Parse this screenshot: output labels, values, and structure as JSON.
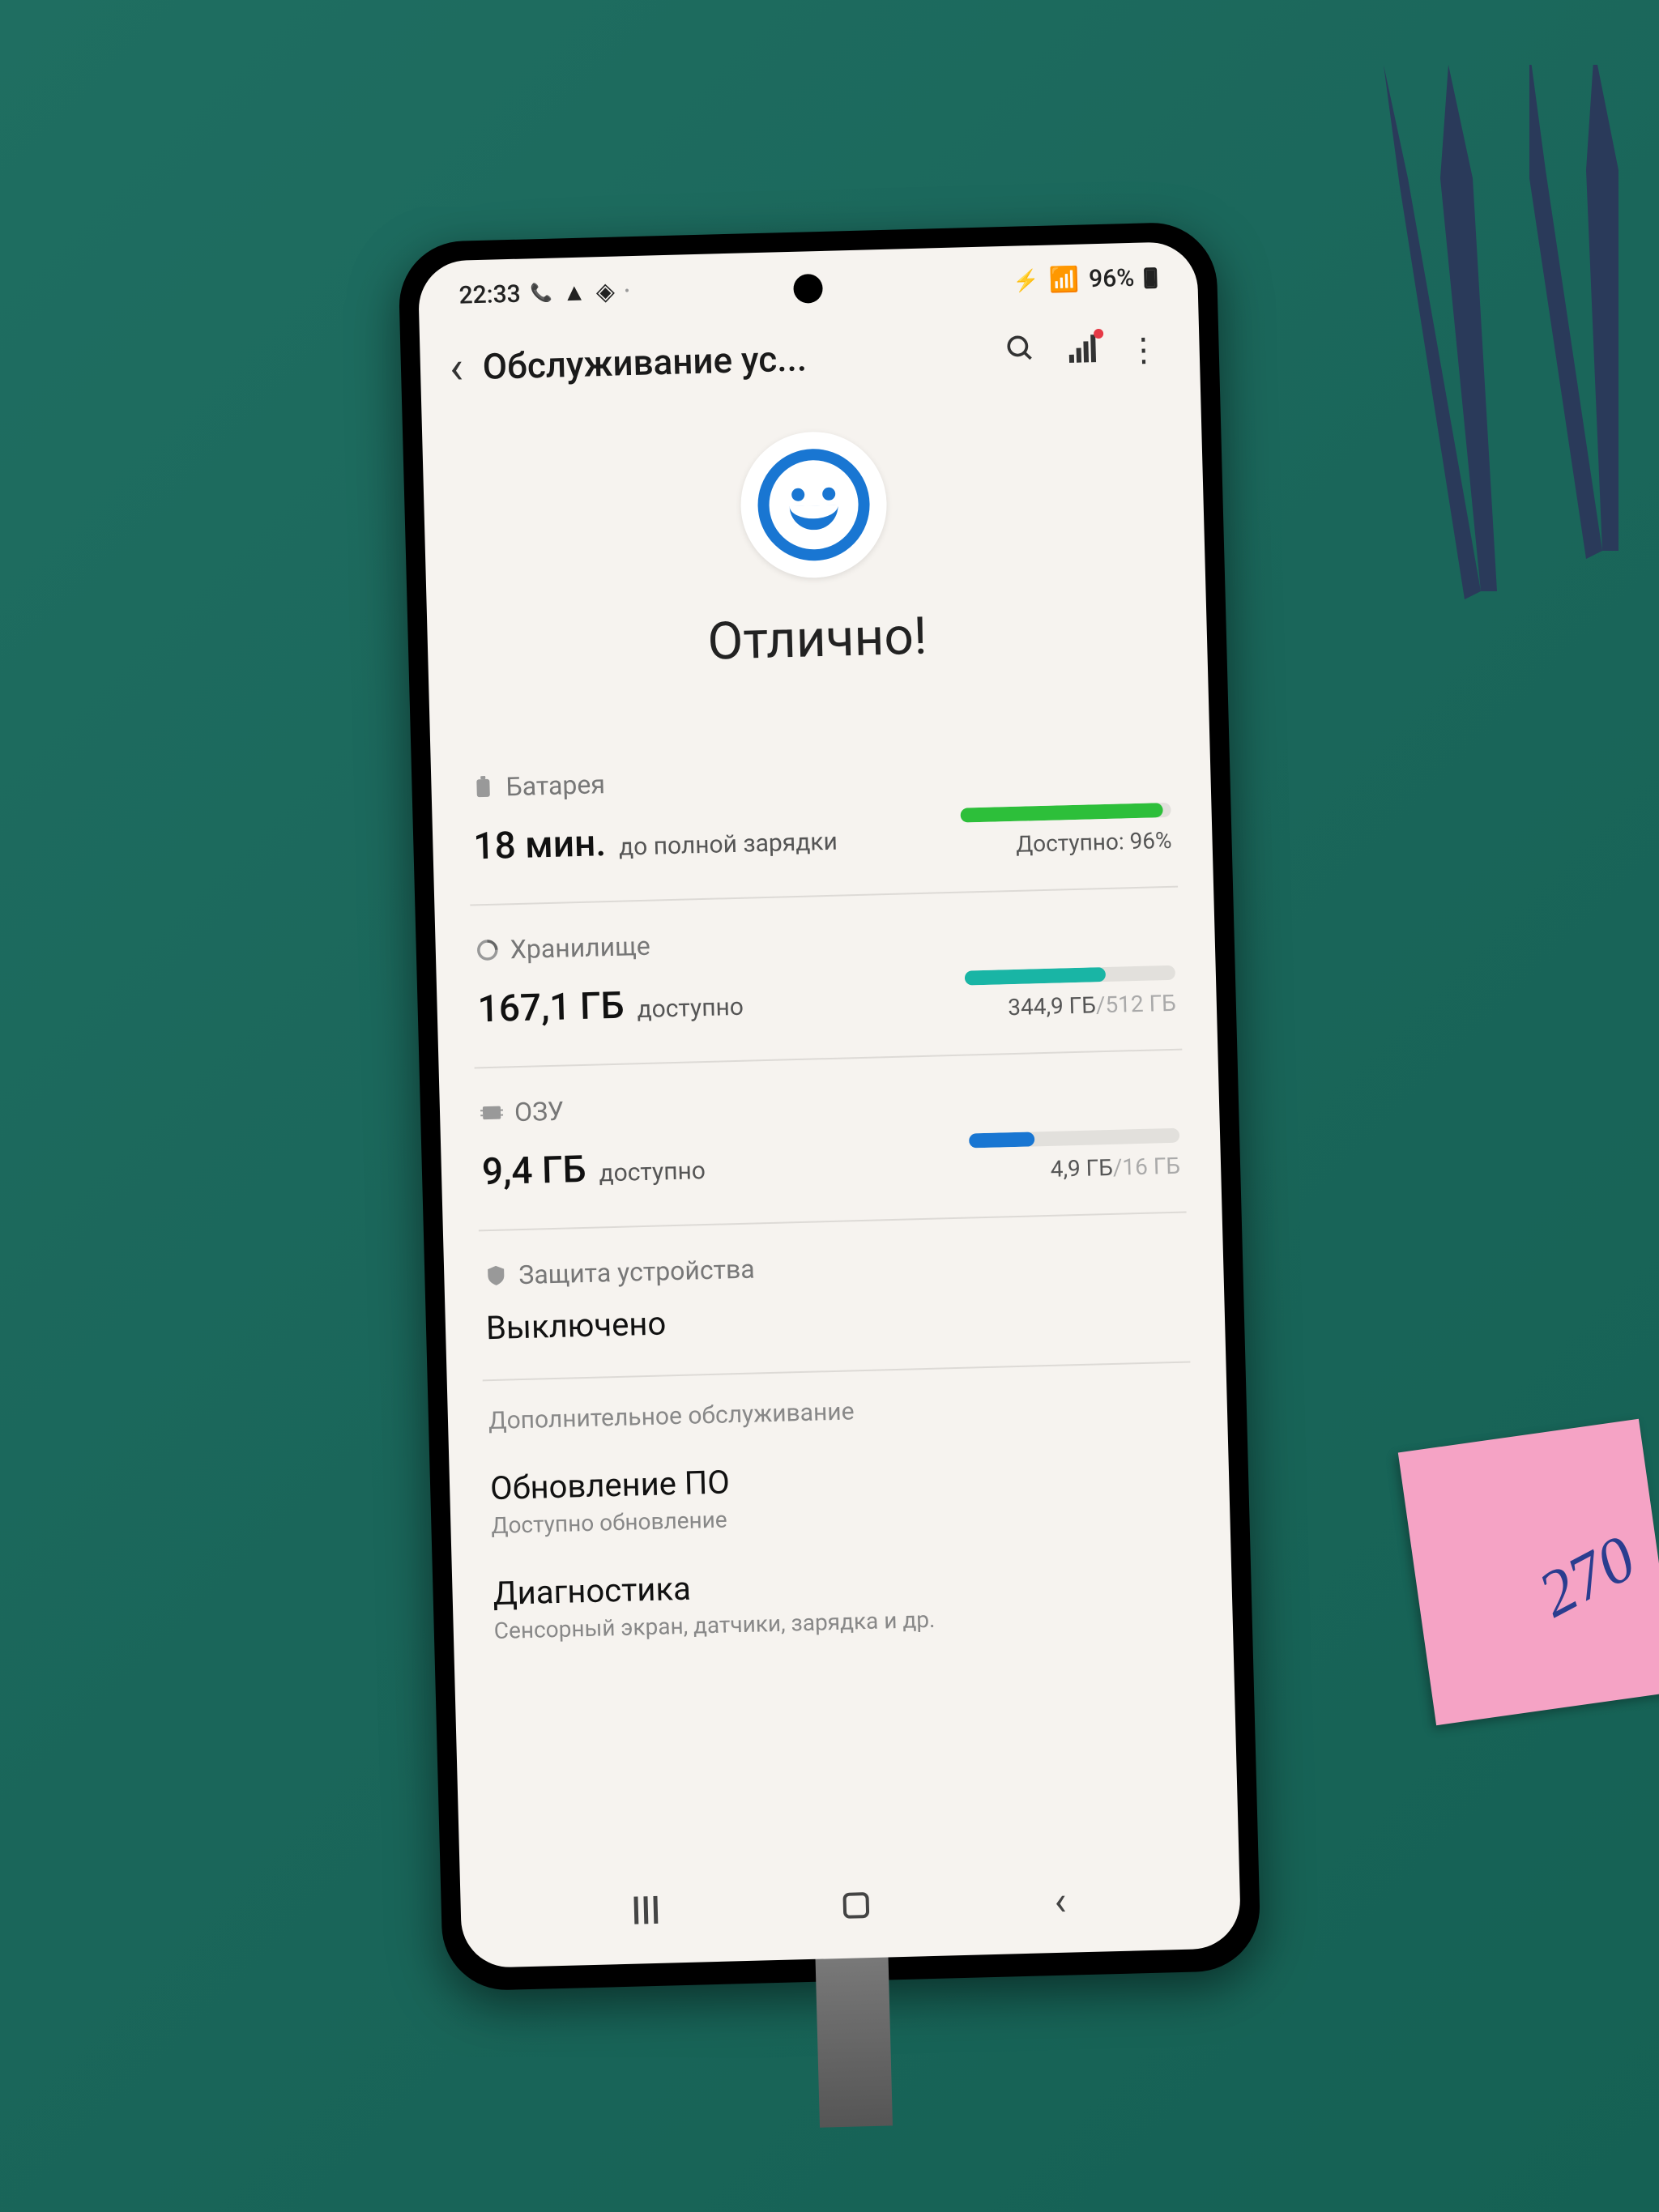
{
  "status_bar": {
    "time": "22:33",
    "battery": "96%"
  },
  "header": {
    "title": "Обслуживание ус..."
  },
  "hero": {
    "status_text": "Отлично!"
  },
  "battery": {
    "label": "Батарея",
    "main_value": "18 мин.",
    "main_suffix": "до полной зарядки",
    "available_text": "Доступно: 96%",
    "fill_percent": 96,
    "color": "#2dbf3a"
  },
  "storage": {
    "label": "Хранилище",
    "main_value": "167,1 ГБ",
    "main_suffix": "доступно",
    "used_text": "344,9 ГБ",
    "total_text": "/512 ГБ",
    "fill_percent": 67,
    "color": "#19b5a5"
  },
  "ram": {
    "label": "ОЗУ",
    "main_value": "9,4 ГБ",
    "main_suffix": "доступно",
    "used_text": "4,9 ГБ",
    "total_text": "/16 ГБ",
    "fill_percent": 31,
    "color": "#1976d2"
  },
  "protection": {
    "label": "Защита устройства",
    "status": "Выключено"
  },
  "additional": {
    "heading": "Дополнительное обслуживание",
    "software_update_title": "Обновление ПО",
    "software_update_sub": "Доступно обновление",
    "diagnostics_title": "Диагностика",
    "diagnostics_sub": "Сенсорный экран, датчики, зарядка и др."
  },
  "sticky_note": "270"
}
